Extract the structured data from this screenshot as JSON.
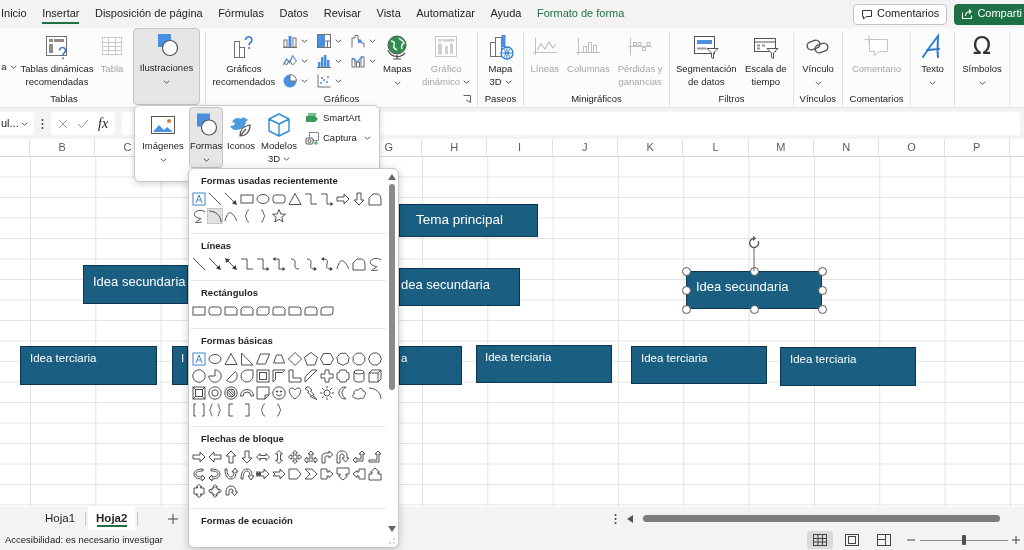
{
  "tabs": [
    {
      "label": "Inicio",
      "kind": "standard",
      "selected": false
    },
    {
      "label": "Insertar",
      "kind": "standard",
      "selected": true
    },
    {
      "label": "Disposición de página",
      "kind": "standard",
      "selected": false
    },
    {
      "label": "Fórmulas",
      "kind": "standard",
      "selected": false
    },
    {
      "label": "Datos",
      "kind": "standard",
      "selected": false
    },
    {
      "label": "Revisar",
      "kind": "standard",
      "selected": false
    },
    {
      "label": "Vista",
      "kind": "standard",
      "selected": false
    },
    {
      "label": "Automatizar",
      "kind": "standard",
      "selected": false
    },
    {
      "label": "Ayuda",
      "kind": "standard",
      "selected": false
    },
    {
      "label": "Formato de forma",
      "kind": "contextual",
      "selected": false
    }
  ],
  "header_buttons": [
    {
      "label": "Comentarios",
      "kind": "outline"
    },
    {
      "label": "Comparti",
      "kind": "primary"
    }
  ],
  "ribbon": {
    "groups": [
      {
        "label": "Tablas",
        "commands": [
          {
            "label": "a",
            "disabled": false,
            "menu": true,
            "expanded": false
          },
          {
            "label": "Tablas dinámicas recomendadas",
            "disabled": false,
            "menu": false,
            "expanded": false
          },
          {
            "label": "Tabla",
            "disabled": true,
            "menu": false,
            "expanded": false
          }
        ]
      },
      {
        "commands": [
          {
            "label": "Ilustraciones",
            "disabled": false,
            "menu": true,
            "expanded": true
          }
        ]
      },
      {
        "label": "Gráficos",
        "commands": [
          {
            "label": "Gráficos recomendados",
            "disabled": false,
            "menu": false,
            "expanded": false
          },
          {
            "label": "Mapas",
            "disabled": false,
            "menu": true,
            "expanded": false
          },
          {
            "label": "Gráfico dinámico",
            "disabled": true,
            "menu": true,
            "expanded": false
          }
        ]
      },
      {
        "label": "Paseos",
        "commands": [
          {
            "label": "Mapa 3D",
            "disabled": false,
            "menu": true,
            "expanded": false
          }
        ]
      },
      {
        "label": "Minigráficos",
        "commands": [
          {
            "label": "Líneas",
            "disabled": true,
            "menu": false,
            "expanded": false
          },
          {
            "label": "Columnas",
            "disabled": true,
            "menu": false,
            "expanded": false
          },
          {
            "label": "Pérdidas y ganancias",
            "disabled": true,
            "menu": false,
            "expanded": false
          }
        ]
      },
      {
        "label": "Filtros",
        "commands": [
          {
            "label": "Segmentación de datos",
            "disabled": false,
            "menu": false,
            "expanded": false
          },
          {
            "label": "Escala de tiempo",
            "disabled": false,
            "menu": false,
            "expanded": false
          }
        ]
      },
      {
        "label": "Vínculos",
        "commands": [
          {
            "label": "Vínculo",
            "disabled": false,
            "menu": true,
            "expanded": false
          }
        ]
      },
      {
        "label": "Comentarios",
        "commands": [
          {
            "label": "Comentario",
            "disabled": true,
            "menu": false,
            "expanded": false
          }
        ]
      },
      {
        "commands": [
          {
            "label": "Texto",
            "disabled": false,
            "menu": true,
            "expanded": false
          }
        ]
      },
      {
        "commands": [
          {
            "label": "Símbolos",
            "glyph": "Ω",
            "disabled": false,
            "menu": true,
            "expanded": false
          }
        ]
      }
    ]
  },
  "illustrations_menu": {
    "items": [
      {
        "label": "Imágenes",
        "kind": "large",
        "menu": true,
        "expanded": false
      },
      {
        "label": "Formas",
        "kind": "large",
        "menu": true,
        "expanded": true
      },
      {
        "label": "Iconos",
        "kind": "large",
        "menu": false,
        "expanded": false
      },
      {
        "label": "Modelos 3D",
        "kind": "large",
        "menu": true,
        "expanded": false
      },
      {
        "label": "SmartArt",
        "kind": "small",
        "menu": false,
        "expanded": false
      },
      {
        "label": "Captura",
        "kind": "small",
        "menu": true,
        "expanded": false
      }
    ]
  },
  "shapes_gallery": {
    "sections": [
      {
        "title": "Formas usadas recientemente",
        "shapes": [
          {
            "kind": "textbox",
            "selected": false
          },
          {
            "kind": "line",
            "selected": false
          },
          {
            "kind": "arrowline",
            "selected": false
          },
          {
            "kind": "rect",
            "selected": false
          },
          {
            "kind": "oval",
            "selected": false
          },
          {
            "kind": "roundrect",
            "selected": false
          },
          {
            "kind": "triangle",
            "selected": false
          },
          {
            "kind": "elbow",
            "selected": false
          },
          {
            "kind": "elbowarrow",
            "selected": false
          },
          {
            "kind": "rightarrow",
            "selected": false
          },
          {
            "kind": "downarrow",
            "selected": false
          },
          {
            "kind": "freeform",
            "selected": false
          },
          {
            "kind": "scribble",
            "selected": false
          },
          {
            "kind": "arc",
            "selected": true
          },
          {
            "kind": "curve",
            "selected": false
          },
          {
            "kind": "lbrace",
            "selected": false
          },
          {
            "kind": "rbrace",
            "selected": false
          },
          {
            "kind": "star",
            "selected": false
          }
        ]
      },
      {
        "title": "Líneas",
        "shapes": [
          {
            "kind": "line",
            "selected": false
          },
          {
            "kind": "arrowline",
            "selected": false
          },
          {
            "kind": "dblarrow",
            "selected": false
          },
          {
            "kind": "elbow",
            "selected": false
          },
          {
            "kind": "elbowarrow",
            "selected": false
          },
          {
            "kind": "elbowdbl",
            "selected": false
          },
          {
            "kind": "curveconn",
            "selected": false
          },
          {
            "kind": "curvearrow",
            "selected": false
          },
          {
            "kind": "curvedbl",
            "selected": false
          },
          {
            "kind": "curve",
            "selected": false
          },
          {
            "kind": "freeform",
            "selected": false
          },
          {
            "kind": "scribble",
            "selected": false
          }
        ]
      },
      {
        "title": "Rectángulos",
        "shapes": [
          {
            "kind": "rect",
            "selected": false
          },
          {
            "kind": "roundrect",
            "selected": false
          },
          {
            "kind": "snip1",
            "selected": false
          },
          {
            "kind": "snip2",
            "selected": false
          },
          {
            "kind": "snipdiag",
            "selected": false
          },
          {
            "kind": "sniprnd",
            "selected": false
          },
          {
            "kind": "round1",
            "selected": false
          },
          {
            "kind": "round2",
            "selected": false
          },
          {
            "kind": "rounddiag",
            "selected": false
          }
        ]
      },
      {
        "title": "Formas básicas",
        "shapes": [
          {
            "kind": "textbox",
            "selected": false
          },
          {
            "kind": "oval",
            "selected": false
          },
          {
            "kind": "triangle",
            "selected": false
          },
          {
            "kind": "rtriangle",
            "selected": false
          },
          {
            "kind": "parallelogram",
            "selected": false
          },
          {
            "kind": "trapezoid",
            "selected": false
          },
          {
            "kind": "diamond",
            "selected": false
          },
          {
            "kind": "pentagon",
            "selected": false
          },
          {
            "kind": "hexagon",
            "selected": false
          },
          {
            "kind": "heptagon",
            "selected": false
          },
          {
            "kind": "octagon",
            "selected": false
          },
          {
            "kind": "decagon",
            "selected": false
          },
          {
            "kind": "dodecagon",
            "selected": false
          },
          {
            "kind": "pie",
            "selected": false
          },
          {
            "kind": "chord",
            "selected": false
          },
          {
            "kind": "teardrop",
            "selected": false
          },
          {
            "kind": "frame",
            "selected": false
          },
          {
            "kind": "halfframe",
            "selected": false
          },
          {
            "kind": "lshape",
            "selected": false
          },
          {
            "kind": "diagstripe",
            "selected": false
          },
          {
            "kind": "cross",
            "selected": false
          },
          {
            "kind": "plaque",
            "selected": false
          },
          {
            "kind": "can",
            "selected": false
          },
          {
            "kind": "cube",
            "selected": false
          },
          {
            "kind": "bevel",
            "selected": false
          },
          {
            "kind": "donut",
            "selected": false
          },
          {
            "kind": "nosymbol",
            "selected": false
          },
          {
            "kind": "blockarc",
            "selected": false
          },
          {
            "kind": "foldedcorner",
            "selected": false
          },
          {
            "kind": "smiley",
            "selected": false
          },
          {
            "kind": "heart",
            "selected": false
          },
          {
            "kind": "lightning",
            "selected": false
          },
          {
            "kind": "sun",
            "selected": false
          },
          {
            "kind": "moon",
            "selected": false
          },
          {
            "kind": "cloud",
            "selected": false
          },
          {
            "kind": "arc",
            "selected": false
          },
          {
            "kind": "dblbracket",
            "selected": false
          },
          {
            "kind": "dblbrace",
            "selected": false
          },
          {
            "kind": "lbracket",
            "selected": false
          },
          {
            "kind": "rbracket",
            "selected": false
          },
          {
            "kind": "lbrace",
            "selected": false
          },
          {
            "kind": "rbrace",
            "selected": false
          }
        ]
      },
      {
        "title": "Flechas de bloque",
        "shapes": [
          {
            "kind": "rightarrow",
            "selected": false
          },
          {
            "kind": "leftarrow",
            "selected": false
          },
          {
            "kind": "uparrow",
            "selected": false
          },
          {
            "kind": "downarrow",
            "selected": false
          },
          {
            "kind": "lrarrow",
            "selected": false
          },
          {
            "kind": "udarrow",
            "selected": false
          },
          {
            "kind": "quadarrow",
            "selected": false
          },
          {
            "kind": "lruparrow",
            "selected": false
          },
          {
            "kind": "bentarrow",
            "selected": false
          },
          {
            "kind": "uturn",
            "selected": false
          },
          {
            "kind": "leftuparrow",
            "selected": false
          },
          {
            "kind": "bentuparrow",
            "selected": false
          },
          {
            "kind": "curvedright",
            "selected": false
          },
          {
            "kind": "curvedleft",
            "selected": false
          },
          {
            "kind": "curvedup",
            "selected": false
          },
          {
            "kind": "curveddown",
            "selected": false
          },
          {
            "kind": "stripedright",
            "selected": false
          },
          {
            "kind": "notchedright",
            "selected": false
          },
          {
            "kind": "homeplate",
            "selected": false
          },
          {
            "kind": "chevron",
            "selected": false
          },
          {
            "kind": "rightcallout",
            "selected": false
          },
          {
            "kind": "downcallout",
            "selected": false
          },
          {
            "kind": "leftcallout",
            "selected": false
          },
          {
            "kind": "upcallout",
            "selected": false
          },
          {
            "kind": "udcallout",
            "selected": false
          },
          {
            "kind": "quadcallout",
            "selected": false
          },
          {
            "kind": "circulararrow",
            "selected": false
          }
        ]
      },
      {
        "title": "Formas de ecuación"
      }
    ]
  },
  "formula_bar": {
    "name_box": "ul...",
    "function_button": "fx"
  },
  "sheet": {
    "columns": [
      "B",
      "C",
      "G",
      "H",
      "I",
      "J",
      "K",
      "L",
      "M",
      "N",
      "O",
      "P"
    ],
    "shapes": [
      {
        "text": "Tema principal",
        "selected": false
      },
      {
        "text": "Idea secundaria",
        "selected": false
      },
      {
        "text": "dea secundaria",
        "selected": false
      },
      {
        "text": "Idea secundaria",
        "selected": true
      },
      {
        "text": "Idea terciaria",
        "selected": false
      },
      {
        "text": "I",
        "selected": false
      },
      {
        "text": "a",
        "selected": false
      },
      {
        "text": "Idea terciaria",
        "selected": false
      },
      {
        "text": "Idea terciaria",
        "selected": false
      },
      {
        "text": "Idea terciaria",
        "selected": false
      }
    ]
  },
  "sheet_tabs": [
    {
      "label": "Hoja1",
      "selected": false
    },
    {
      "label": "Hoja2",
      "selected": true
    }
  ],
  "status_bar": {
    "text": "Accesibilidad: es necesario investigar",
    "views": [
      {
        "selected": true
      },
      {
        "selected": false
      },
      {
        "selected": false
      }
    ],
    "zoom": {
      "level": 0.5
    }
  }
}
